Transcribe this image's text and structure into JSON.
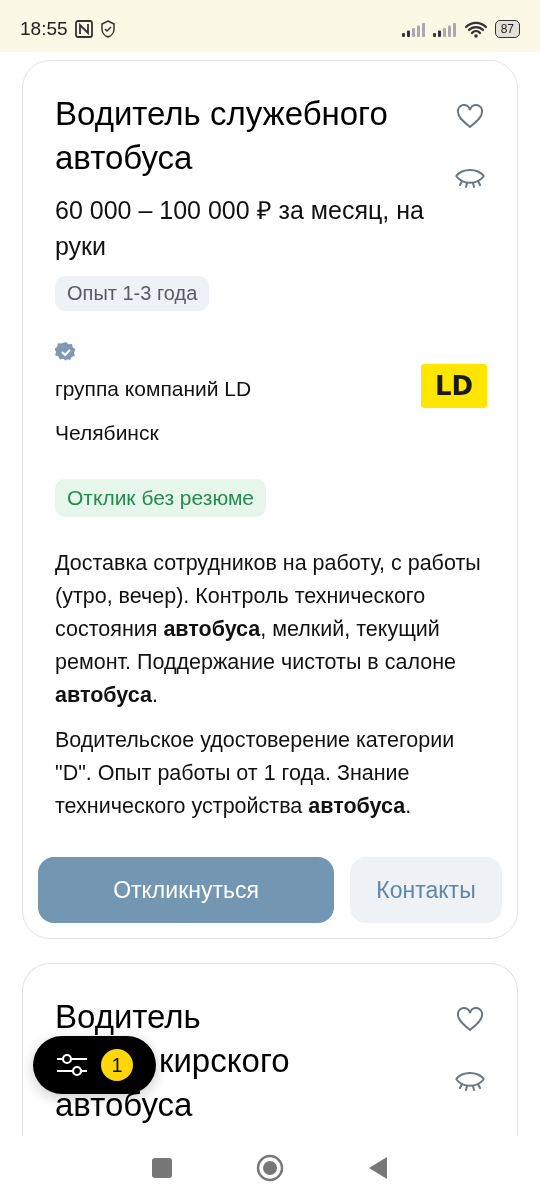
{
  "status_bar": {
    "time": "18:55",
    "battery": "87"
  },
  "cards": [
    {
      "title_lines": [
        "Водитель служебного",
        "автобуса"
      ],
      "salary": "60 000 – 100 000 ₽ за месяц, на руки",
      "experience": "Опыт 1-3 года",
      "verified": true,
      "company": "группа компаний LD",
      "logo_text": "LD",
      "city": "Челябинск",
      "badge": "Отклик без резюме",
      "paragraphs": [
        "Доставка сотрудников на работу, с работы (утро, вечер). Контроль технического состояния **автобуса**, мелкий, текущий ремонт. Поддержание чистоты в салоне **автобуса**.",
        "Водительское удостоверение категории \"D\". Опыт работы от 1 года. Знание технического устройства **автобуса**."
      ],
      "buttons": [
        {
          "kind": "primary",
          "label": "Откликнуться"
        },
        {
          "kind": "secondary",
          "label": "Контакты"
        }
      ]
    },
    {
      "title_lines": [
        "Водитель",
        "кирского",
        "автобуса"
      ]
    }
  ],
  "filter_button": {
    "count": "1"
  }
}
